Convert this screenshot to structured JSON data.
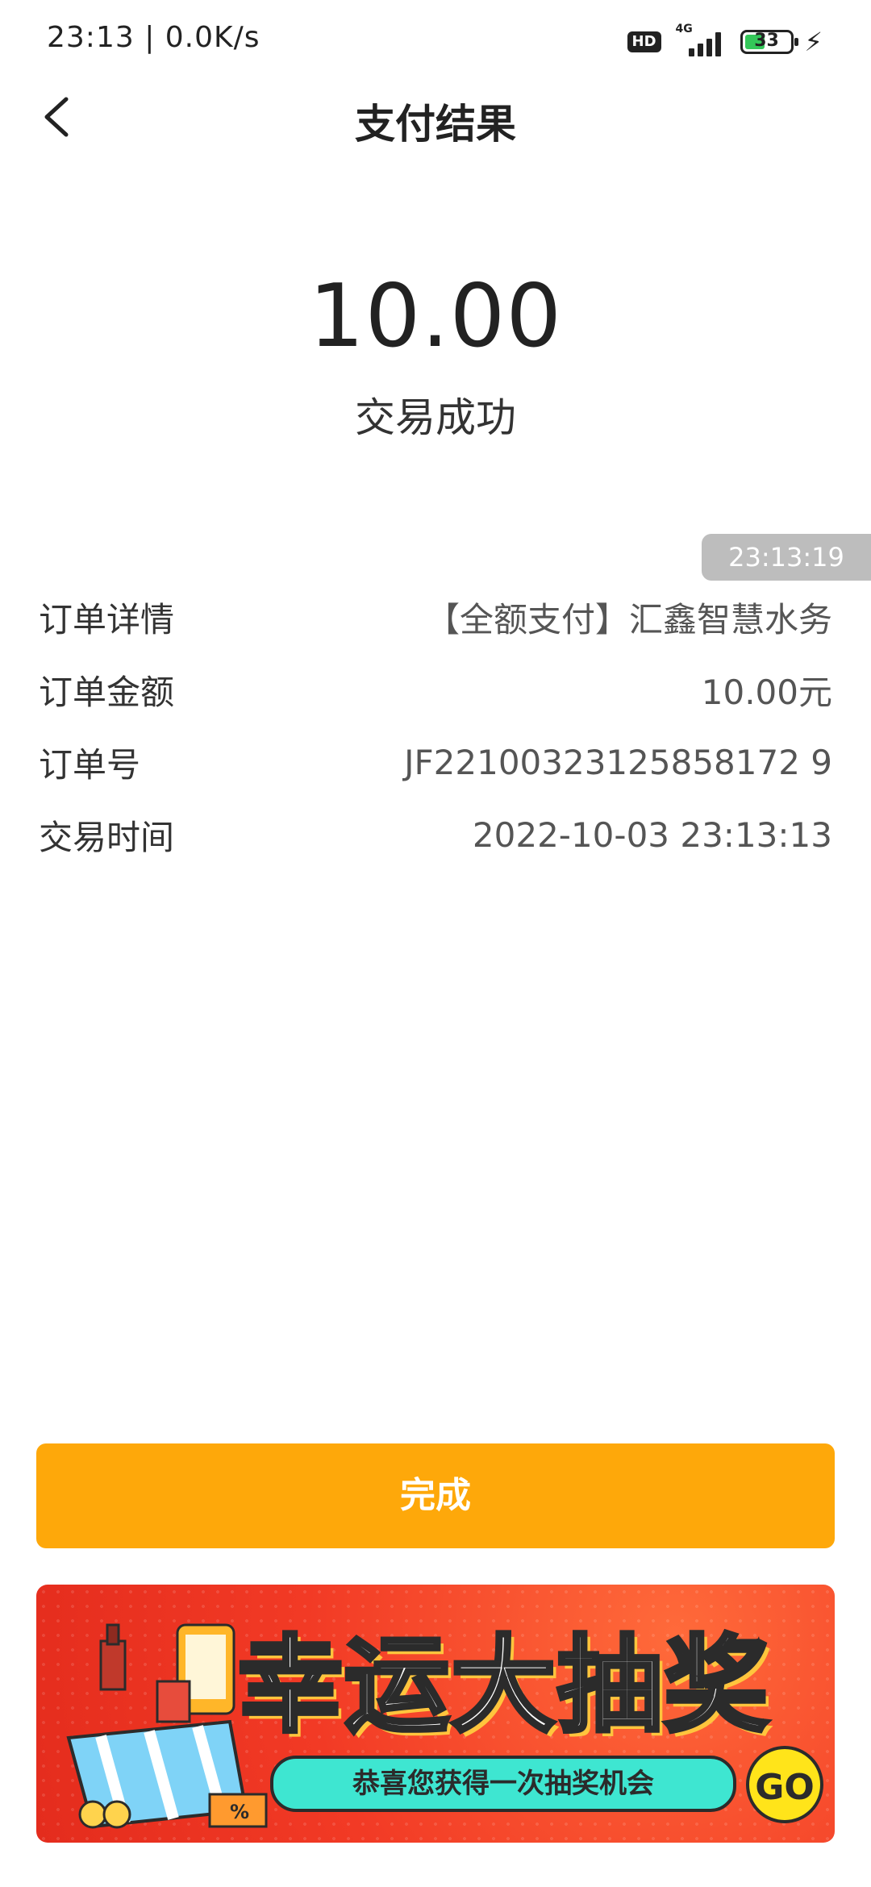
{
  "status_bar": {
    "time_speed": "23:13 | 0.0K/s",
    "hd_label": "HD",
    "network_label": "4G",
    "battery_level": "33",
    "charging_icon": "bolt-icon"
  },
  "header": {
    "title": "支付结果",
    "back_icon": "chevron-left-icon"
  },
  "payment": {
    "amount": "10.00",
    "status": "交易成功"
  },
  "timestamp_bubble": "23:13:19",
  "details": [
    {
      "key": "订单详情",
      "value": "【全额支付】汇鑫智慧水务"
    },
    {
      "key": "订单金额",
      "value": "10.00元"
    },
    {
      "key": "订单号",
      "value": "JF22100323125858172 9"
    },
    {
      "key": "交易时间",
      "value": "2022-10-03 23:13:13"
    }
  ],
  "done_button": "完成",
  "banner": {
    "title": "幸运大抽奖",
    "subtitle": "恭喜您获得一次抽奖机会",
    "go_label": "GO"
  },
  "colors": {
    "accent": "#fea80a",
    "banner_red": "#f23a25",
    "banner_pill": "#3ee6d1",
    "go_yellow": "#ffe41a"
  }
}
